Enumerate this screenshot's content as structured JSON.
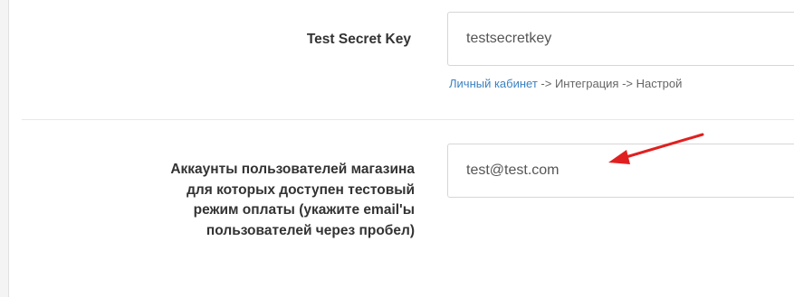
{
  "fields": {
    "secret_key": {
      "label": "Test Secret Key",
      "value": "testsecretkey"
    },
    "help": {
      "link_text": "Личный кабинет",
      "rest_text": " -> Интеграция -> Настрой"
    },
    "accounts": {
      "label_lines": [
        "Аккаунты пользователей магазина",
        "для которых доступен тестовый",
        "режим оплаты (укажите email'ы",
        "пользователей через пробел)"
      ],
      "value": "test@test.com"
    }
  },
  "colors": {
    "arrow": "#e02020",
    "link": "#3c82c0",
    "input_border": "#d6d6d6"
  }
}
